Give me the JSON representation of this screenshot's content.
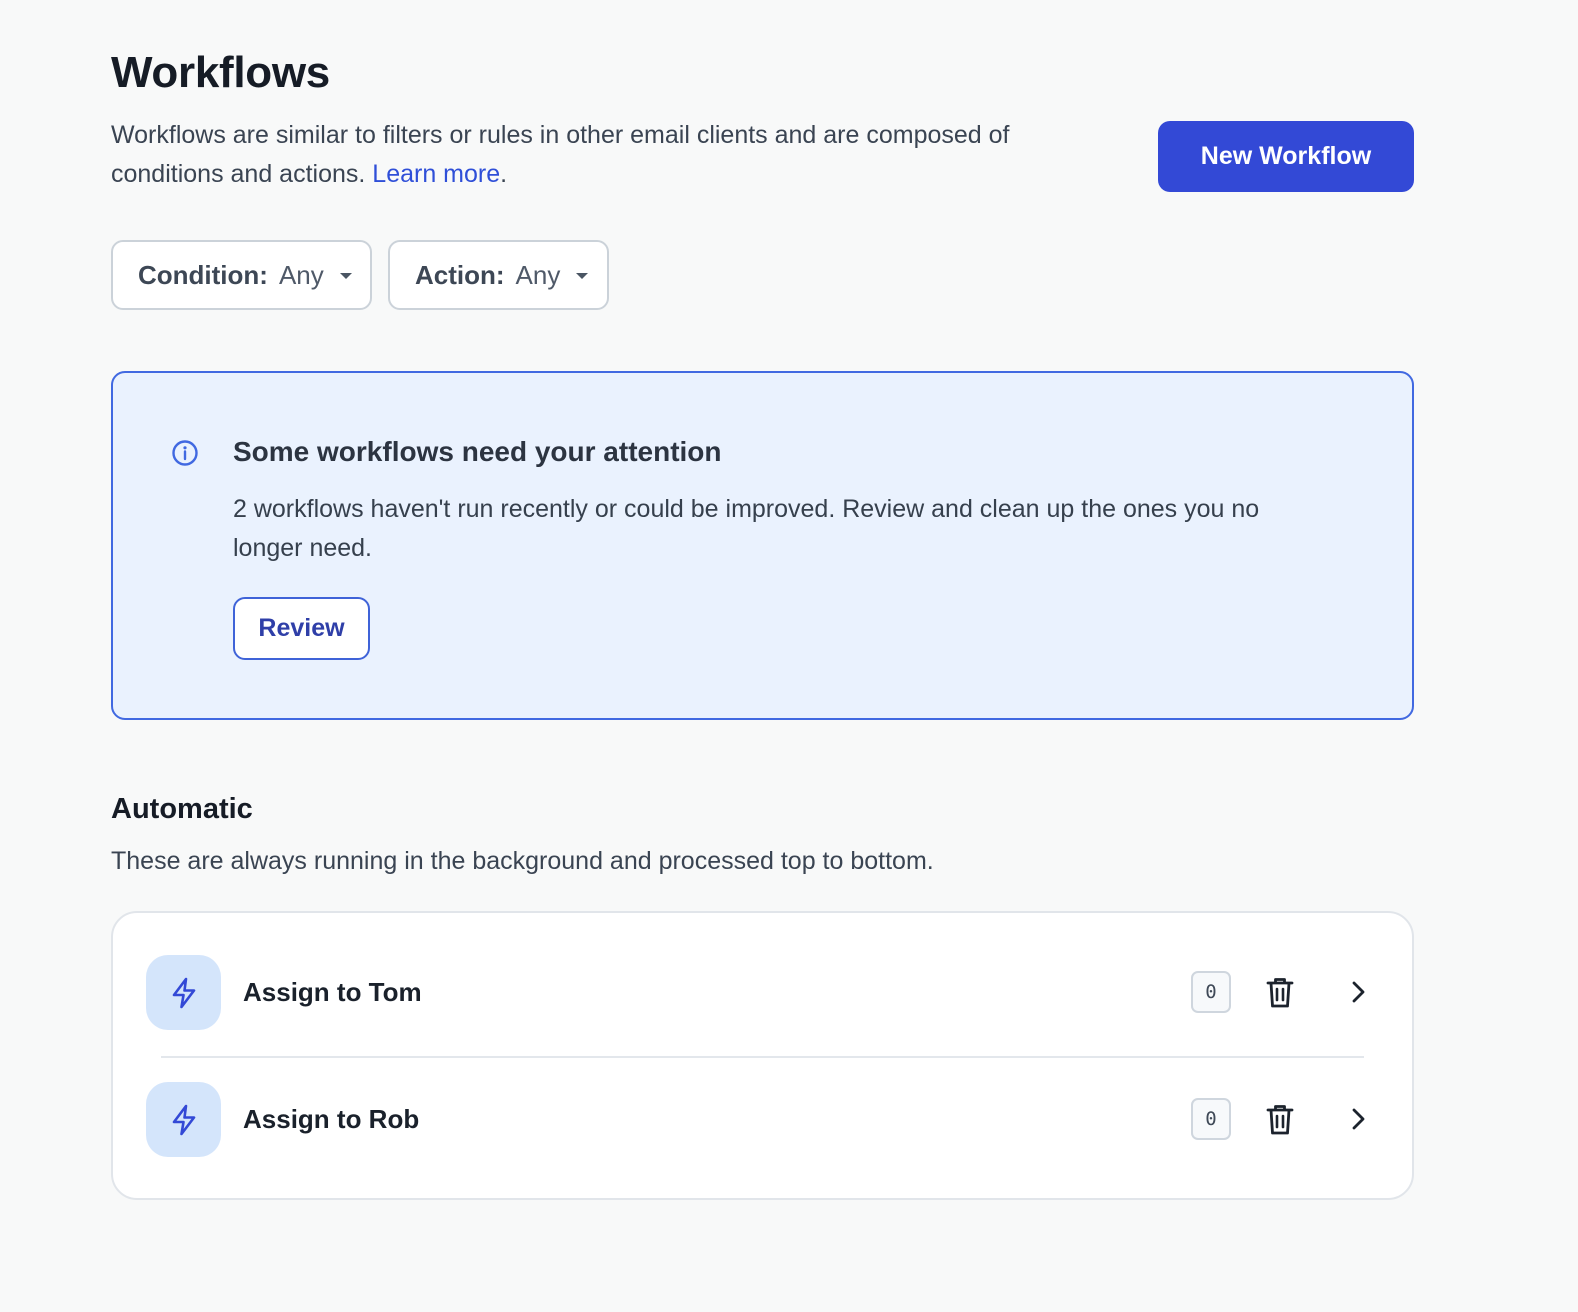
{
  "page": {
    "title": "Workflows",
    "description": "Workflows are similar to filters or rules in other email clients and are composed of conditions and actions.",
    "learn_more": "Learn more",
    "description_end": ".",
    "new_button": "New Workflow"
  },
  "filters": {
    "condition": {
      "label": "Condition:",
      "value": "Any",
      "icon": "caret-down-icon"
    },
    "action": {
      "label": "Action:",
      "value": "Any",
      "icon": "caret-down-icon"
    }
  },
  "alert": {
    "icon": "info-icon",
    "title": "Some workflows need your attention",
    "body": "2 workflows haven't run recently or could be improved. Review and clean up the ones you no longer need.",
    "button": "Review"
  },
  "automatic": {
    "title": "Automatic",
    "description": "These are always running in the background and processed top to bottom.",
    "workflows": [
      {
        "name": "Assign to Tom",
        "count": "0",
        "icon": "lightning-bolt-icon"
      },
      {
        "name": "Assign to Rob",
        "count": "0",
        "icon": "lightning-bolt-icon"
      }
    ]
  },
  "colors": {
    "primary": "#3349d6",
    "link": "#2f4fd8",
    "alert_bg": "#eaf2fe",
    "alert_border": "#4169e1",
    "badge_bg": "#d4e5fb",
    "page_bg": "#f8f9f9"
  }
}
